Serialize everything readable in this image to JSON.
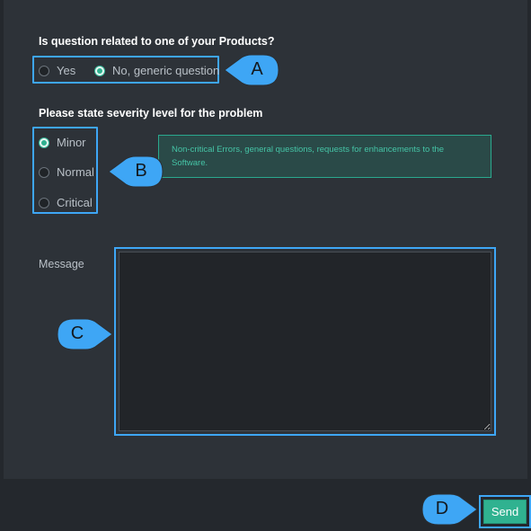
{
  "question1": {
    "label": "Is question related to one of your Products?",
    "options": [
      {
        "label": "Yes",
        "checked": false
      },
      {
        "label": "No, generic question",
        "checked": true
      }
    ]
  },
  "severity": {
    "label": "Please state severity level for the problem",
    "options": [
      {
        "label": "Minor",
        "checked": true
      },
      {
        "label": "Normal",
        "checked": false
      },
      {
        "label": "Critical",
        "checked": false
      }
    ],
    "info": "Non-critical Errors, general questions, requests for enhancements to the Software."
  },
  "message": {
    "label": "Message",
    "value": ""
  },
  "send": {
    "label": "Send"
  },
  "callouts": {
    "a": "A",
    "b": "B",
    "c": "C",
    "d": "D"
  },
  "colors": {
    "accent": "#30b290",
    "highlight": "#3ea6f5",
    "panel": "#2d3238",
    "background": "#24282d"
  }
}
